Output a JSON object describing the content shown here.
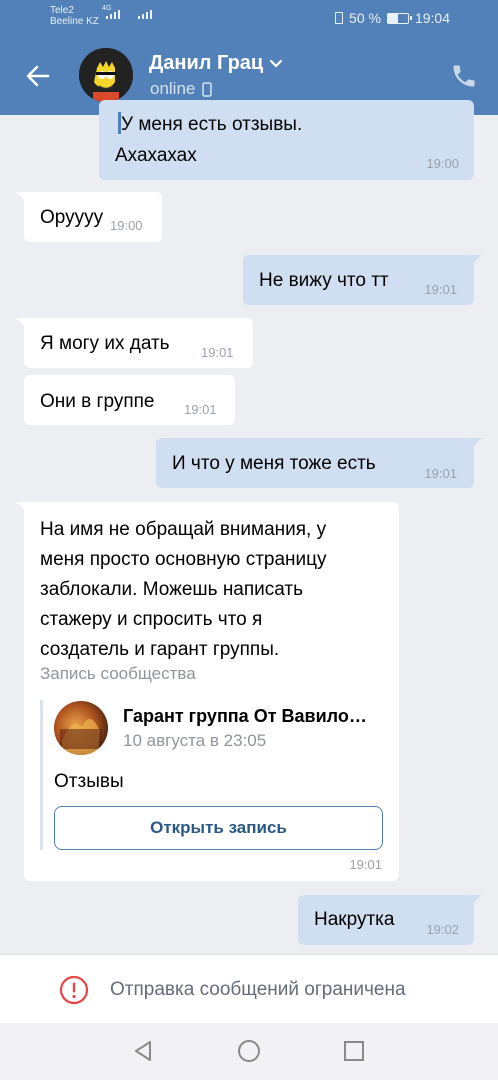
{
  "status_bar": {
    "carrier_1": "Tele2",
    "carrier_2": "Beeline KZ",
    "network": "4G",
    "battery_text": "50 %",
    "battery_level": 0.5,
    "time": "19:04"
  },
  "header": {
    "name": "Данил Грац",
    "status": "online"
  },
  "messages": [
    {
      "direction": "out",
      "quote": "У меня есть отзывы.",
      "text": "Ахахахах",
      "time": "19:00"
    },
    {
      "direction": "in",
      "text": "Оруууу",
      "time": "19:00"
    },
    {
      "direction": "out",
      "text": "Не вижу что тт",
      "time": "19:01"
    },
    {
      "direction": "in",
      "text": "Я могу их дать",
      "time": "19:01"
    },
    {
      "direction": "in",
      "text": "Они в группе",
      "time": "19:01"
    },
    {
      "direction": "out",
      "text": "И что у меня тоже есть",
      "time": "19:01"
    },
    {
      "direction": "in",
      "lines": [
        "На имя не обращай внимания, у",
        "меня просто основную страницу",
        "заблокали. Можешь написать",
        "стажеру и спросить что я",
        "создатель и гарант группы."
      ],
      "time": "19:01",
      "repost": {
        "label": "Запись сообщества",
        "group_name": "Гарант группа От Вавило…",
        "date": "10 августа в 23:05",
        "text": "Отзывы",
        "button": "Открыть запись"
      }
    },
    {
      "direction": "out",
      "text": "Накрутка",
      "time": "19:02"
    }
  ],
  "restriction": {
    "text": "Отправка сообщений ограничена"
  },
  "colors": {
    "header": "#5181b8",
    "outgoing_bubble": "#cfdef1",
    "incoming_bubble": "#ffffff",
    "background": "#eceef1",
    "alert": "#e64646"
  }
}
